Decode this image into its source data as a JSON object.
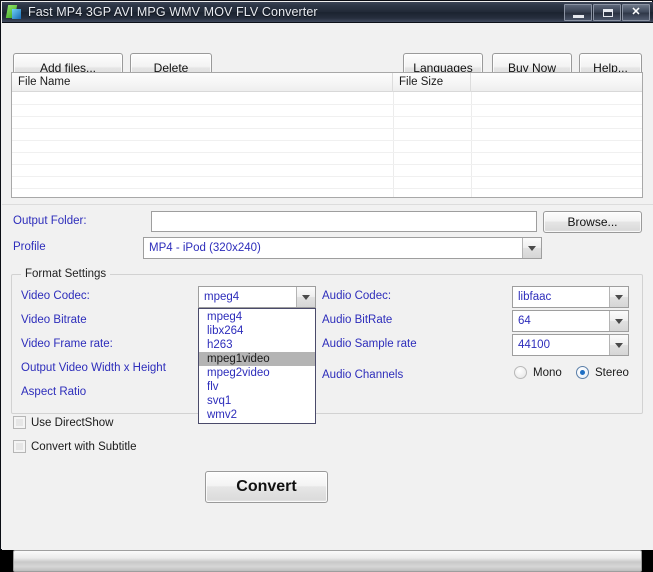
{
  "window": {
    "title": "Fast MP4 3GP AVI MPG WMV MOV FLV Converter",
    "icon": "app-icon",
    "controls": {
      "minimize": "minimize-icon",
      "maximize": "maximize-icon",
      "close": "✕"
    }
  },
  "toolbar": {
    "add_files": "Add files...",
    "delete": "Delete",
    "languages": "Languages",
    "buy_now": "Buy Now",
    "help": "Help..."
  },
  "file_list": {
    "columns": [
      "File Name",
      "File Size",
      ""
    ],
    "rows": []
  },
  "output": {
    "folder_label": "Output Folder:",
    "folder_value": "",
    "folder_placeholder": "",
    "browse_label": "Browse...",
    "profile_label": "Profile",
    "profile_value": "MP4 - iPod (320x240)"
  },
  "format_settings": {
    "group_title": "Format Settings",
    "video": {
      "codec_label": "Video Codec:",
      "codec_value": "mpeg4",
      "codec_options": [
        "mpeg4",
        "libx264",
        "h263",
        "mpeg1video",
        "mpeg2video",
        "flv",
        "svq1",
        "wmv2"
      ],
      "codec_highlighted": "mpeg1video",
      "bitrate_label": "Video Bitrate",
      "framerate_label": "Video Frame rate:",
      "size_label": "Output Video Width x Height",
      "aspect_label": "Aspect Ratio"
    },
    "audio": {
      "codec_label": "Audio Codec:",
      "codec_value": "libfaac",
      "bitrate_label": "Audio BitRate",
      "bitrate_value": "64",
      "samplerate_label": "Audio Sample rate",
      "samplerate_value": "44100",
      "channels_label": "Audio Channels",
      "mono_label": "Mono",
      "stereo_label": "Stereo",
      "channels_selected": "Stereo"
    }
  },
  "options": {
    "use_directshow": "Use DirectShow",
    "use_directshow_checked": false,
    "convert_with_subtitle": "Convert with Subtitle",
    "convert_with_subtitle_checked": false
  },
  "actions": {
    "convert": "Convert"
  },
  "progress": {
    "value": 0
  },
  "colors": {
    "label_blue": "#2d2dbb",
    "titlebar_dark": "#222a38",
    "accent_radio": "#1f6fc4",
    "window_bg": "#f1f1f1"
  }
}
